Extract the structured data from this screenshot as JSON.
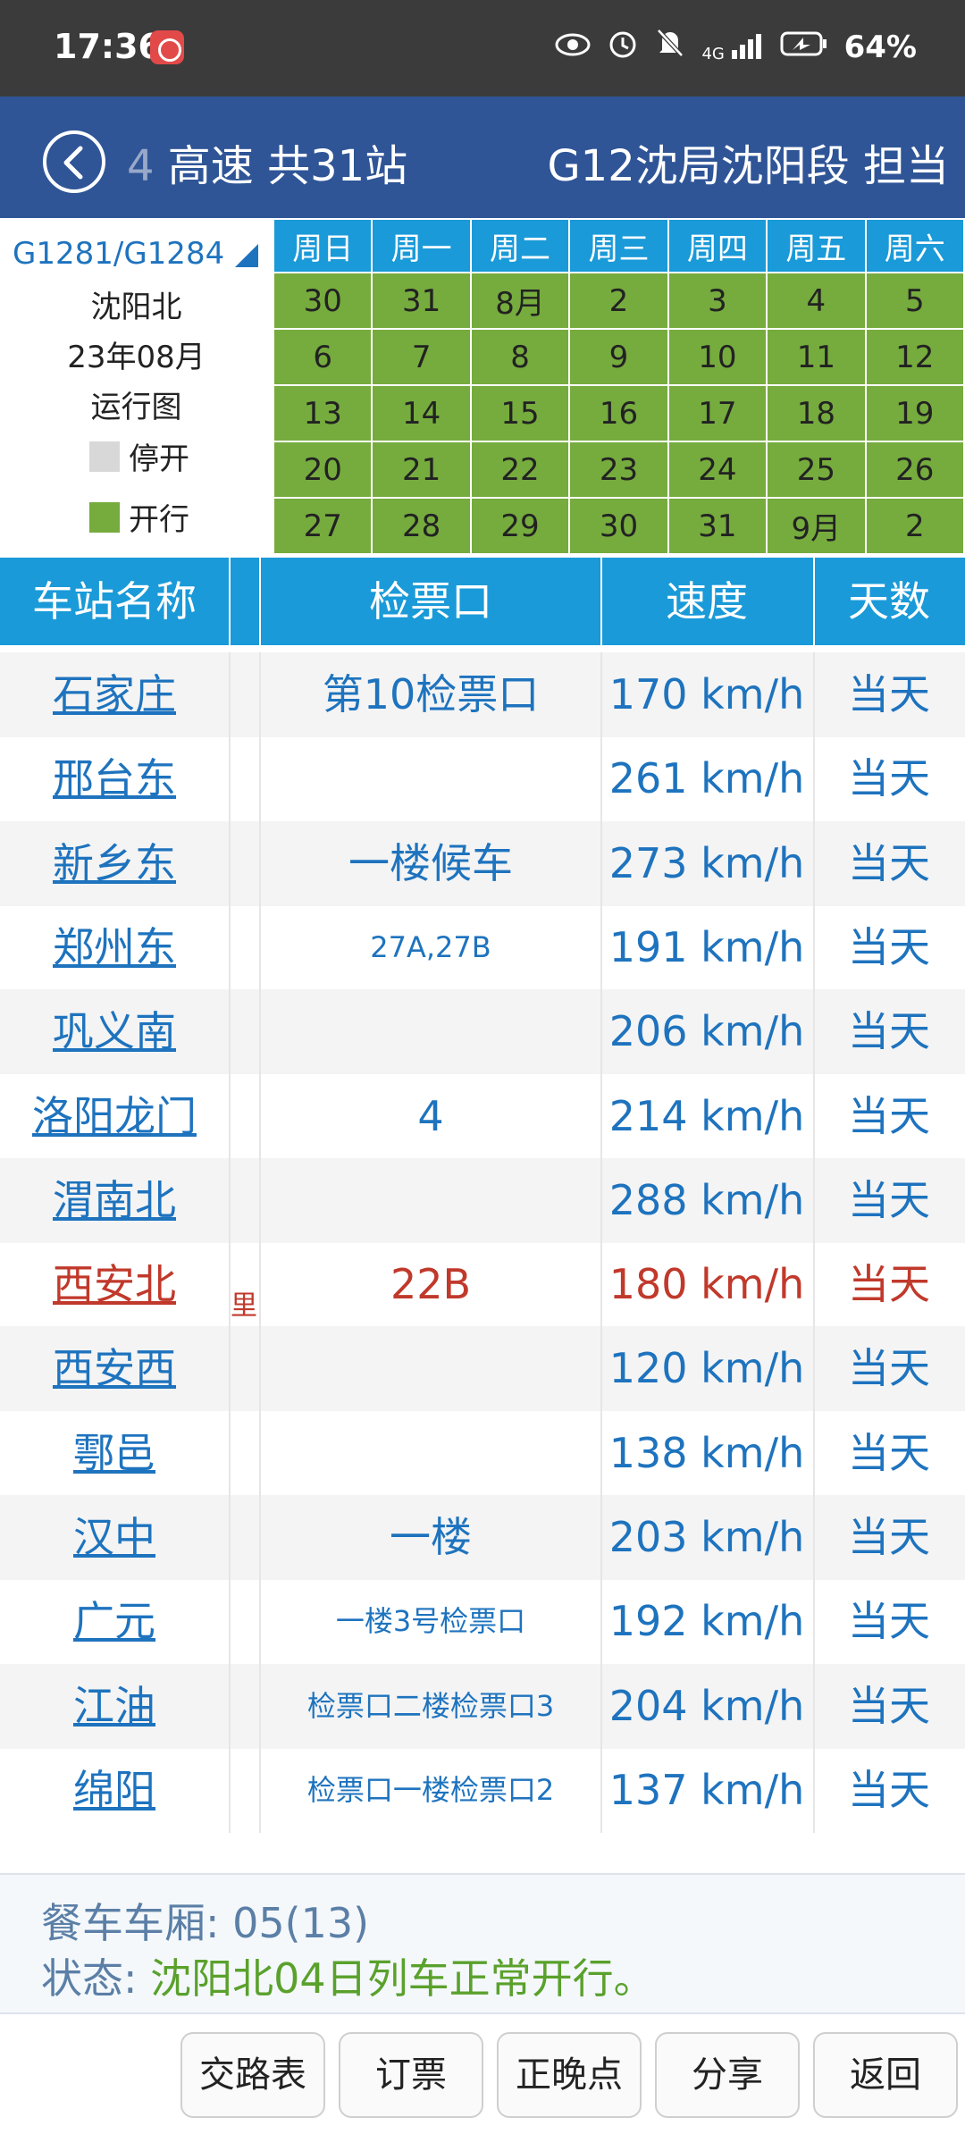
{
  "status_bar": {
    "time": "17:36",
    "icons": [
      "eye-icon",
      "alarm-icon",
      "mute-icon",
      "signal-icon"
    ],
    "network": "4G",
    "battery": "64%"
  },
  "header": {
    "left_prefix": "4",
    "left_text": " 高速 共31站",
    "right_code": "G12",
    "right_text": "沈局沈阳段 担当"
  },
  "info": {
    "train_no": "G1281/G1284",
    "station": "沈阳北",
    "month": "23年08月",
    "chart_label": "运行图",
    "legend_stop": "停开",
    "legend_run": "开行",
    "colors": {
      "stop": "#d8d8d8",
      "run": "#76ab3e",
      "header": "#1a9ad8"
    }
  },
  "calendar": {
    "weekdays": [
      "周日",
      "周一",
      "周二",
      "周三",
      "周四",
      "周五",
      "周六"
    ],
    "weeks": [
      [
        "30",
        "31",
        "8月",
        "2",
        "3",
        "4",
        "5"
      ],
      [
        "6",
        "7",
        "8",
        "9",
        "10",
        "11",
        "12"
      ],
      [
        "13",
        "14",
        "15",
        "16",
        "17",
        "18",
        "19"
      ],
      [
        "20",
        "21",
        "22",
        "23",
        "24",
        "25",
        "26"
      ],
      [
        "27",
        "28",
        "29",
        "30",
        "31",
        "9月",
        "2"
      ]
    ]
  },
  "table": {
    "headers": {
      "station": "车站名称",
      "gate": "检票口",
      "speed": "速度",
      "days": "天数"
    },
    "rows": [
      {
        "station": "石家庄",
        "gate": "第10检票口",
        "speed": "170 km/h",
        "days": "当天",
        "extra": "",
        "highlight": false,
        "small": false
      },
      {
        "station": "邢台东",
        "gate": "",
        "speed": "261 km/h",
        "days": "当天",
        "extra": "",
        "highlight": false,
        "small": false
      },
      {
        "station": "新乡东",
        "gate": "一楼候车",
        "speed": "273 km/h",
        "days": "当天",
        "extra": "",
        "highlight": false,
        "small": false
      },
      {
        "station": "郑州东",
        "gate": "27A,27B",
        "speed": "191 km/h",
        "days": "当天",
        "extra": "",
        "highlight": false,
        "small": true
      },
      {
        "station": "巩义南",
        "gate": "",
        "speed": "206 km/h",
        "days": "当天",
        "extra": "",
        "highlight": false,
        "small": false
      },
      {
        "station": "洛阳龙门",
        "gate": "4",
        "speed": "214 km/h",
        "days": "当天",
        "extra": "",
        "highlight": false,
        "small": false
      },
      {
        "station": "渭南北",
        "gate": "",
        "speed": "288 km/h",
        "days": "当天",
        "extra": "",
        "highlight": false,
        "small": false
      },
      {
        "station": "西安北",
        "gate": "22B",
        "speed": "180 km/h",
        "days": "当天",
        "extra": "里",
        "highlight": true,
        "small": false
      },
      {
        "station": "西安西",
        "gate": "",
        "speed": "120 km/h",
        "days": "当天",
        "extra": "",
        "highlight": false,
        "small": false
      },
      {
        "station": "鄠邑",
        "gate": "",
        "speed": "138 km/h",
        "days": "当天",
        "extra": "",
        "highlight": false,
        "small": false
      },
      {
        "station": "汉中",
        "gate": "一楼",
        "speed": "203 km/h",
        "days": "当天",
        "extra": "",
        "highlight": false,
        "small": false
      },
      {
        "station": "广元",
        "gate": "一楼3号检票口",
        "speed": "192 km/h",
        "days": "当天",
        "extra": "",
        "highlight": false,
        "small": true
      },
      {
        "station": "江油",
        "gate": "检票口二楼检票口3",
        "speed": "204 km/h",
        "days": "当天",
        "extra": "",
        "highlight": false,
        "small": true
      },
      {
        "station": "绵阳",
        "gate": "检票口一楼检票口2",
        "speed": "137 km/h",
        "days": "当天",
        "extra": "",
        "highlight": false,
        "small": true
      }
    ]
  },
  "footer": {
    "dining_label": "餐车车厢: 05(13)",
    "status_label": "状态: ",
    "status_text": "沈阳北04日列车正常开行。"
  },
  "buttons": [
    "交路表",
    "订票",
    "正晚点",
    "分享",
    "返回"
  ]
}
